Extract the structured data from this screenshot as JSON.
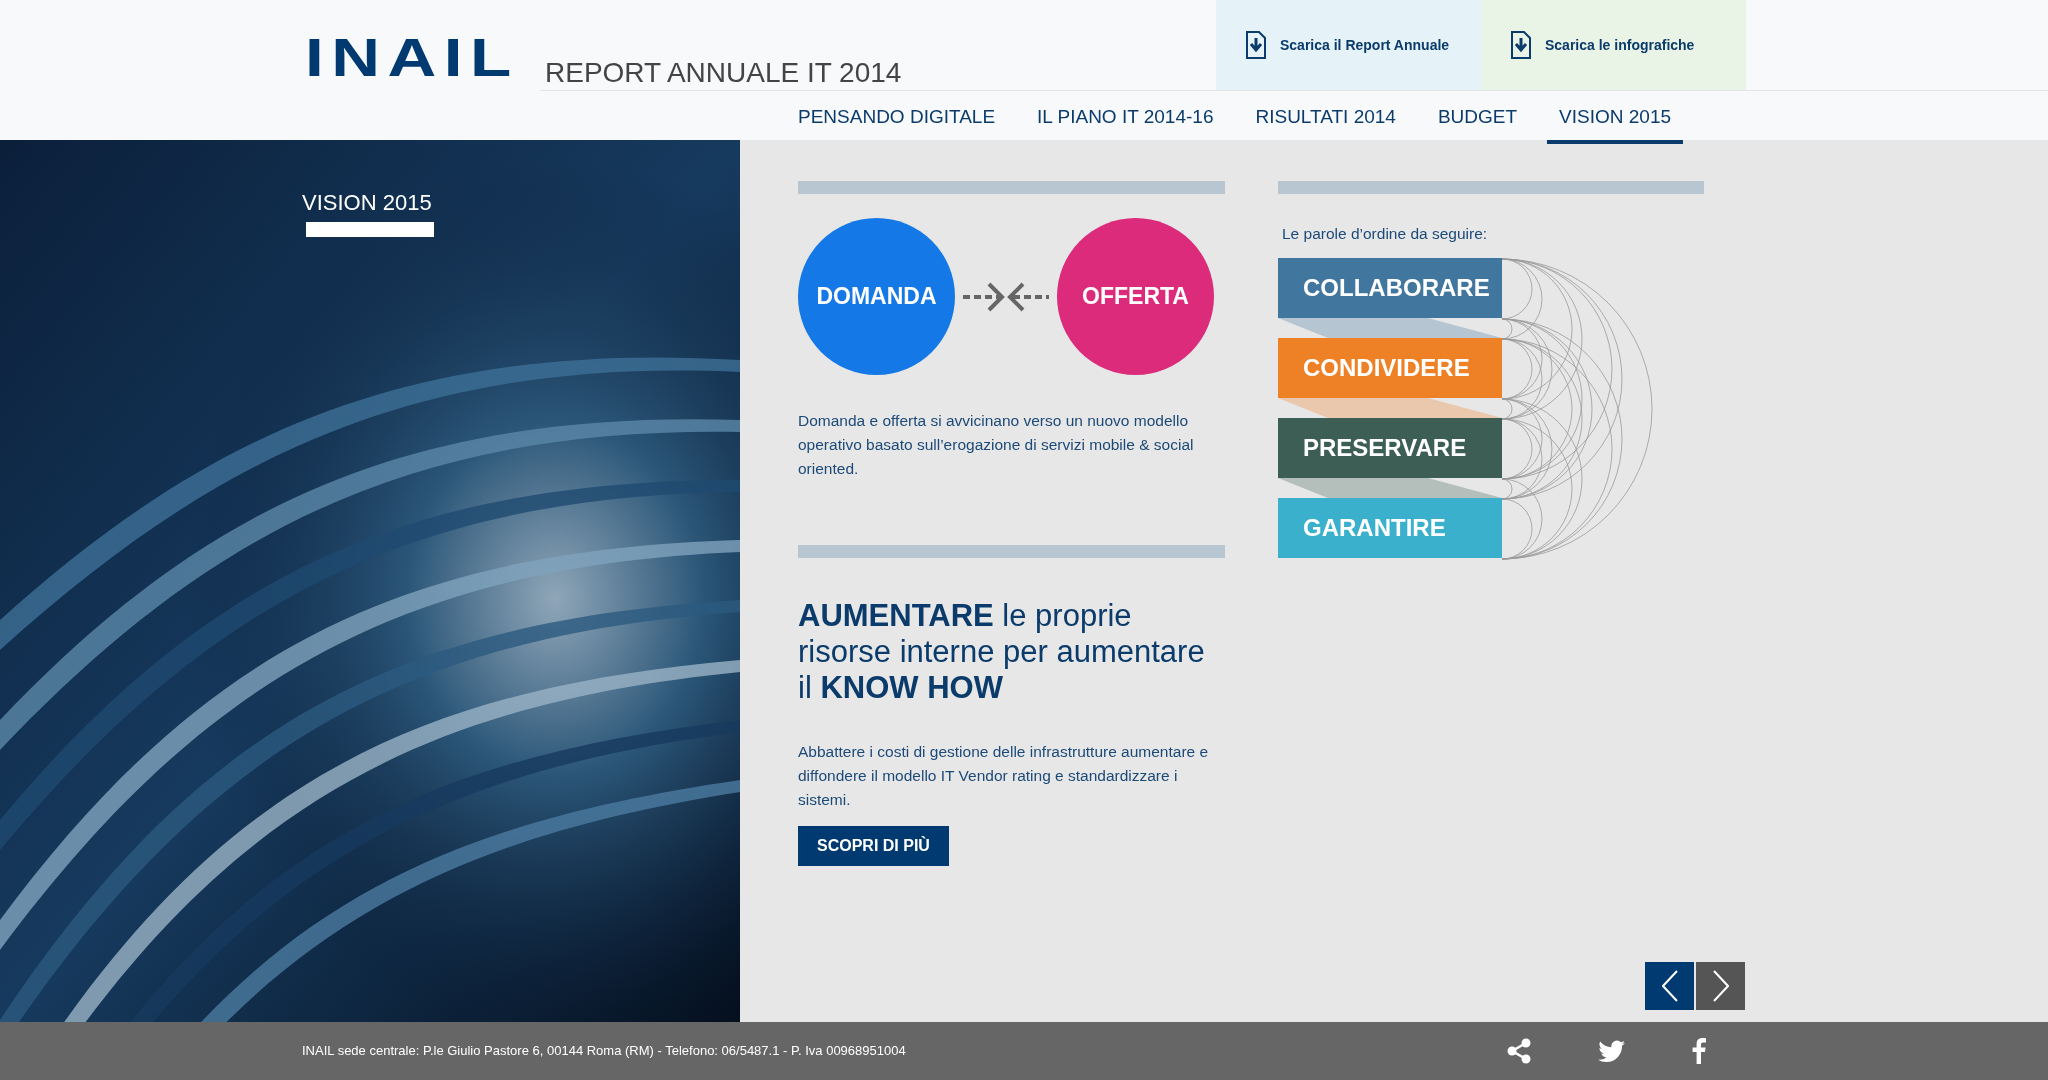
{
  "header": {
    "logo": "INAIL",
    "title": "REPORT ANNUALE IT 2014",
    "downloads": [
      {
        "label": "Scarica il Report Annuale",
        "color": "#e5f2f8"
      },
      {
        "label": "Scarica le infografiche",
        "color": "#eaf4e6"
      }
    ]
  },
  "nav": [
    {
      "label": "PENSANDO DIGITALE",
      "selected": false
    },
    {
      "label": "IL PIANO IT 2014-16",
      "selected": false
    },
    {
      "label": "RISULTATI 2014",
      "selected": false
    },
    {
      "label": "BUDGET",
      "selected": false
    },
    {
      "label": "VISION 2015",
      "selected": true
    }
  ],
  "side": {
    "kind": "picture",
    "title": "VISION 2015"
  },
  "demand_offer": {
    "left": "DOMANDA",
    "right": "OFFERTA",
    "text": "Domanda e offerta si avvicinano verso un nuovo modello operativo basato sull’erogazione di servizi mobile & social oriented."
  },
  "increase": {
    "heading": "**AUMENTARE** le proprie risorse interne per aumentare il **KNOW HOW**",
    "text": "Abbattere i costi di gestione delle infrastrutture aumentare e diffondere il modello IT Vendor rating e standardizzare i sistemi.",
    "button": "SCOPRI DI PIÙ"
  },
  "keywords": {
    "intro": "Le parole d’ordine da seguire:",
    "items": [
      {
        "label": "COLLABORARE",
        "color": "#41769e"
      },
      {
        "label": "CONDIVIDERE",
        "color": "#ee8126"
      },
      {
        "label": "PRESERVARE",
        "color": "#3c5e55"
      },
      {
        "label": "GARANTIRE",
        "color": "#3ab0cc"
      }
    ]
  },
  "footer": {
    "address": "INAIL sede centrale: P.le Giulio Pastore 6, 00144 Roma (RM) - Telefono: 06/5487.1 - P. Iva 00968951004"
  }
}
